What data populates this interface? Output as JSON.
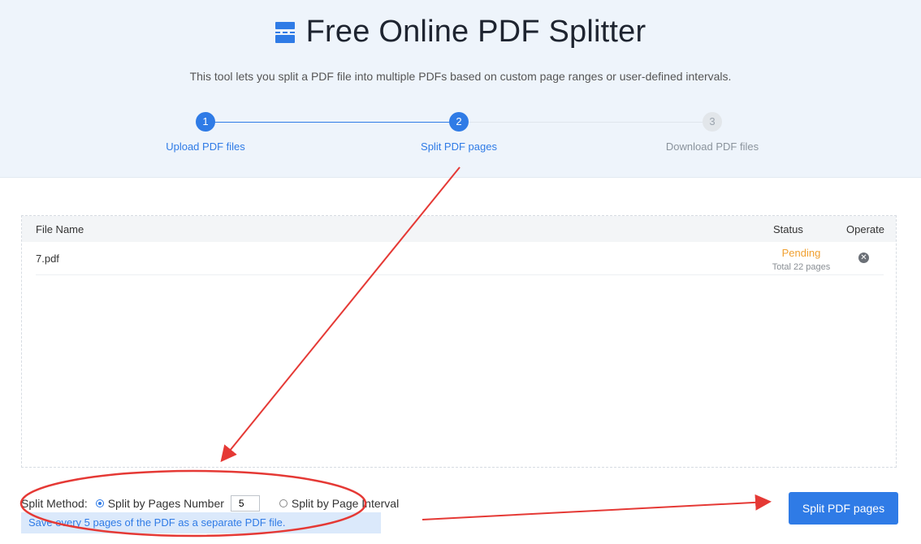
{
  "header": {
    "title": "Free Online PDF Splitter",
    "subtitle": "This tool lets you split a PDF file into multiple PDFs based on custom page ranges or user-defined intervals.",
    "logo_icon": "split-document-icon"
  },
  "steps": [
    {
      "number": "1",
      "label": "Upload PDF files",
      "state": "done"
    },
    {
      "number": "2",
      "label": "Split PDF pages",
      "state": "active"
    },
    {
      "number": "3",
      "label": "Download PDF files",
      "state": "todo"
    }
  ],
  "file_table": {
    "columns": {
      "name": "File Name",
      "status": "Status",
      "operate": "Operate"
    },
    "rows": [
      {
        "name": "7.pdf",
        "status": "Pending",
        "detail": "Total 22 pages",
        "remove_icon": "close-circle-icon"
      }
    ]
  },
  "split": {
    "method_label": "Split Method:",
    "option_pages_number": "Split by Pages Number",
    "pages_value": "5",
    "option_page_interval": "Split by Page Interval",
    "selected": "pages_number",
    "hint": "Save every 5 pages of the PDF as a separate PDF file."
  },
  "actions": {
    "split_button": "Split PDF pages"
  },
  "colors": {
    "accent": "#2f7be6",
    "pending": "#f0a030",
    "annotation": "#e53935"
  }
}
